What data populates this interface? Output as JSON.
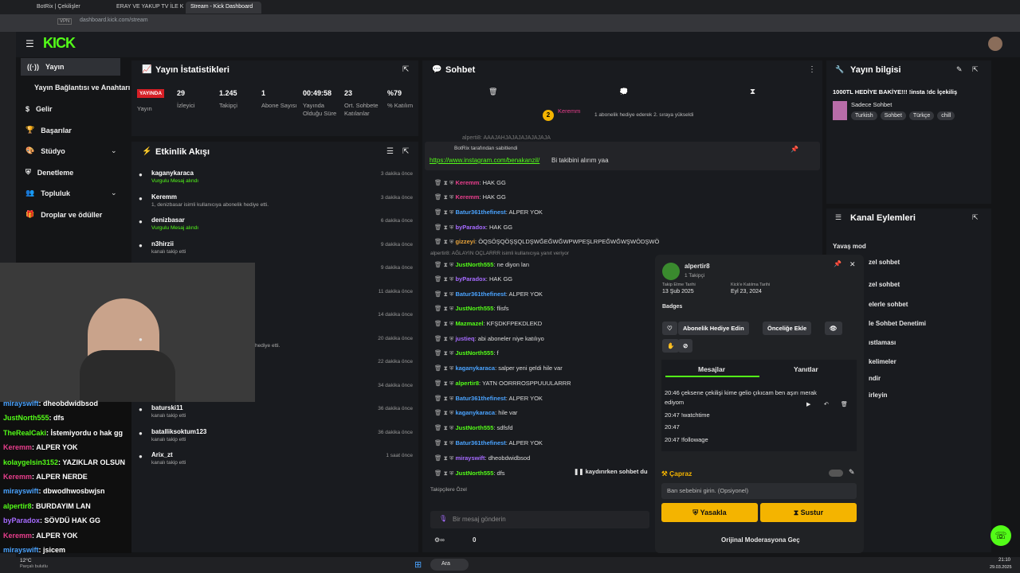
{
  "browser": {
    "tabs": [
      "BotRix | Çekilişler",
      "ERAY VE YAKUP TV İLE K",
      "Stream - Kick Dashboard"
    ],
    "url": "dashboard.kick.com/stream",
    "vpn": "VPN"
  },
  "sidebar": {
    "items": [
      "Yayın",
      "Yayın Bağlantısı ve Anahtarı",
      "Gelir",
      "Başarılar",
      "Stüdyo",
      "Denetleme",
      "Topluluk",
      "Droplar ve ödüller"
    ]
  },
  "stats": {
    "title": "Yayın İstatistikleri",
    "live": "YAYINDA",
    "live_label": "Yayın",
    "items": [
      {
        "v": "29",
        "l": "İzleyici"
      },
      {
        "v": "1.245",
        "l": "Takipçi"
      },
      {
        "v": "1",
        "l": "Abone Sayısı"
      },
      {
        "v": "00:49:58",
        "l": "Yayında Olduğu Süre"
      },
      {
        "v": "23",
        "l": "Ort. Sohbete Katılanlar"
      },
      {
        "v": "%79",
        "l": "% Katılım"
      }
    ]
  },
  "feed": {
    "title": "Etkinlik Akışı",
    "items": [
      {
        "n": "kaganykaracа",
        "s": "Vurgulu Mesaj alındı",
        "t": "3 dakika önce"
      },
      {
        "n": "Keremm",
        "s": "1, denizbasar isimli kullanıcıya abonelik hediye etti.",
        "t": "3 dakika önce"
      },
      {
        "n": "denizbasar",
        "s": "Vurgulu Mesaj alındı",
        "t": "6 dakika önce"
      },
      {
        "n": "n3hirzii",
        "s": "kanalı takip etti",
        "t": "9 dakika önce"
      },
      {
        "n": "",
        "s": "",
        "t": "9 dakika önce"
      },
      {
        "n": "",
        "s": "",
        "t": "11 dakika önce"
      },
      {
        "n": "",
        "s": "",
        "t": "14 dakika önce"
      },
      {
        "n": "",
        "s": "hediye etti.",
        "t": "20 dakika önce"
      },
      {
        "n": "",
        "s": "",
        "t": "22 dakika önce"
      },
      {
        "n": "",
        "s": "",
        "t": "34 dakika önce"
      },
      {
        "n": "baturski11",
        "s": "kanalı takip etti",
        "t": "36 dakika önce"
      },
      {
        "n": "batalliksoktum123",
        "s": "kanalı takip etti",
        "t": "36 dakika önce"
      },
      {
        "n": "Arix_zt",
        "s": "kanalı takip etti",
        "t": "1 saat önce"
      }
    ]
  },
  "chat": {
    "title": "Sohbet",
    "gift_user": "Keremm",
    "gift_count": "2",
    "gift_text": "1 abonelik hediye ederek 2. sıraya yükseldi",
    "pinned_by": "BotRix tarafından sabitlendi",
    "pinned_link": "https://www.instagram.com/benakanzil/",
    "pinned_text": "Bi takibini alırım yaa",
    "truncated": "alperti8: AAAJAHJAJAJAJAJAJAJA",
    "messages": [
      {
        "u": "Keremm",
        "m": ": HAK GG",
        "c": "#e83e8c"
      },
      {
        "u": "Keremm",
        "m": ": HAK GG",
        "c": "#e83e8c"
      },
      {
        "u": "Batur361thefinest",
        "m": ": ALPER YOK",
        "c": "#4aa3ff"
      },
      {
        "u": "byParadox",
        "m": ": HAK GG",
        "c": "#a66bff"
      },
      {
        "u": "gizzeyi",
        "m": ": ÖQSÖŞQÖŞŞQLDŞWĞEĞWĞWPWPEŞLRPEĞWĞWŞWÖDŞWÖ",
        "c": "#e8a33a"
      },
      {
        "u": "JustNorth555",
        "m": ": ne diyon lan",
        "c": "#53fc18"
      },
      {
        "u": "byParadox",
        "m": ": HAK GG",
        "c": "#a66bff"
      },
      {
        "u": "Batur361thefinest",
        "m": ": ALPER YOK",
        "c": "#4aa3ff"
      },
      {
        "u": "JustNorth555",
        "m": ": flisfs",
        "c": "#53fc18"
      },
      {
        "u": "Mazmazel",
        "m": ": KFŞDKFPEKDLEKD",
        "c": "#53fc18"
      },
      {
        "u": "justieq",
        "m": ": abi aboneler niye katılıyo",
        "c": "#a66bff"
      },
      {
        "u": "JustNorth555",
        "m": ": f",
        "c": "#53fc18"
      },
      {
        "u": "kaganykaracа",
        "m": ": salper yeni geldi hile var",
        "c": "#4aa3ff"
      },
      {
        "u": "alpertir8",
        "m": ": YATN OORRROSPPUUULARRR",
        "c": "#53fc18"
      },
      {
        "u": "Batur361thefinest",
        "m": ": ALPER YOK",
        "c": "#4aa3ff"
      },
      {
        "u": "kaganykaracа",
        "m": ": hile var",
        "c": "#4aa3ff"
      },
      {
        "u": "JustNorth555",
        "m": ": sdfsfd",
        "c": "#53fc18"
      },
      {
        "u": "Batur361thefinest",
        "m": ": ALPER YOK",
        "c": "#4aa3ff"
      },
      {
        "u": "mirayswift",
        "m": ": dheobdwidbsod",
        "c": "#a66bff"
      },
      {
        "u": "JustNorth555",
        "m": ": dfs",
        "c": "#53fc18"
      }
    ],
    "reply_note": "alpertir8: AĞLAYIN OÇLARRR isimli kullanıcıya yanıt veriyor",
    "paused": "kaydırırken sohbet du",
    "special": "Takipçilere Özel",
    "placeholder": "Bir mesaj gönderin",
    "count": "0"
  },
  "info": {
    "title": "Yayın bilgisi",
    "stream_title": "1000TL HEDİYE BAKİYE!!! !insta !dc İçekiliş",
    "category": "Sadece Sohbet",
    "tags": [
      "Turkish",
      "Sohbet",
      "Türkçe",
      "chill"
    ]
  },
  "actions": {
    "title": "Kanal Eylemleri",
    "items": [
      "Yavaş mod",
      "zel sohbet",
      "zel sohbet",
      "elerle sohbet",
      "le Sohbet Denetimi",
      "ıstlaması",
      "kelimeler",
      "ndir",
      "irleyin"
    ]
  },
  "user": {
    "name": "alpertir8",
    "followers": "1 Takipçi",
    "follow_label": "Takip Etme Tarihi",
    "follow_date": "13 Şub 2025",
    "join_label": "Kick'e Katılma Tarihi",
    "join_date": "Eyl 23, 2024",
    "badges": "Badges",
    "gift_btn": "Abonelik Hediye Edin",
    "priority_btn": "Önceliğe Ekle",
    "tab_messages": "Mesajlar",
    "tab_replies": "Yanıtlar",
    "msgs": [
      {
        "t": "20:46",
        "m": "çeksene çekilişi kime gelio çıkıcam ben aşırı merak ediyom"
      },
      {
        "t": "20:47",
        "m": "!watchtime"
      },
      {
        "t": "20:47",
        "m": ""
      },
      {
        "t": "20:47",
        "m": "!followage"
      }
    ],
    "ban_title": "Çapraz",
    "reason_placeholder": "Ban sebebini girin. (Opsiyonel)",
    "ban_btn": "Yasakla",
    "mute_btn": "Sustur",
    "original": "Orijinal Moderasyona Geç"
  },
  "cam_chat": [
    {
      "u": "mirayswift",
      "m": ": dheobdwidbsod",
      "c": "#4aa3ff"
    },
    {
      "u": "JustNorth555",
      "m": ": dfs",
      "c": "#53fc18"
    },
    {
      "u": "TheRealCaki",
      "m": ": İstemiyordu o hak gg",
      "c": "#53fc18"
    },
    {
      "u": "Keremm",
      "m": ": ALPER YOK",
      "c": "#e83e8c"
    },
    {
      "u": "kolaygelsin3152",
      "m": ": YAZIKLAR OLSUN",
      "c": "#53fc18"
    },
    {
      "u": "Keremm",
      "m": ": ALPER NERDE",
      "c": "#e83e8c"
    },
    {
      "u": "mirayswift",
      "m": ": dbwodhwosbwjsn",
      "c": "#4aa3ff"
    },
    {
      "u": "alpertir8",
      "m": ": BURDAYIM LAN",
      "c": "#53fc18"
    },
    {
      "u": "byParadox",
      "m": ": SÖVDÜ HAK GG",
      "c": "#a66bff"
    },
    {
      "u": "Keremm",
      "m": ": ALPER YOK",
      "c": "#e83e8c"
    },
    {
      "u": "mirayswift",
      "m": ": jsicem",
      "c": "#4aa3ff"
    }
  ],
  "taskbar": {
    "weather": "12°C",
    "weather_sub": "Parçalı bulutlu",
    "search": "Ara",
    "time": "21:10",
    "date": "29.03.2025"
  }
}
